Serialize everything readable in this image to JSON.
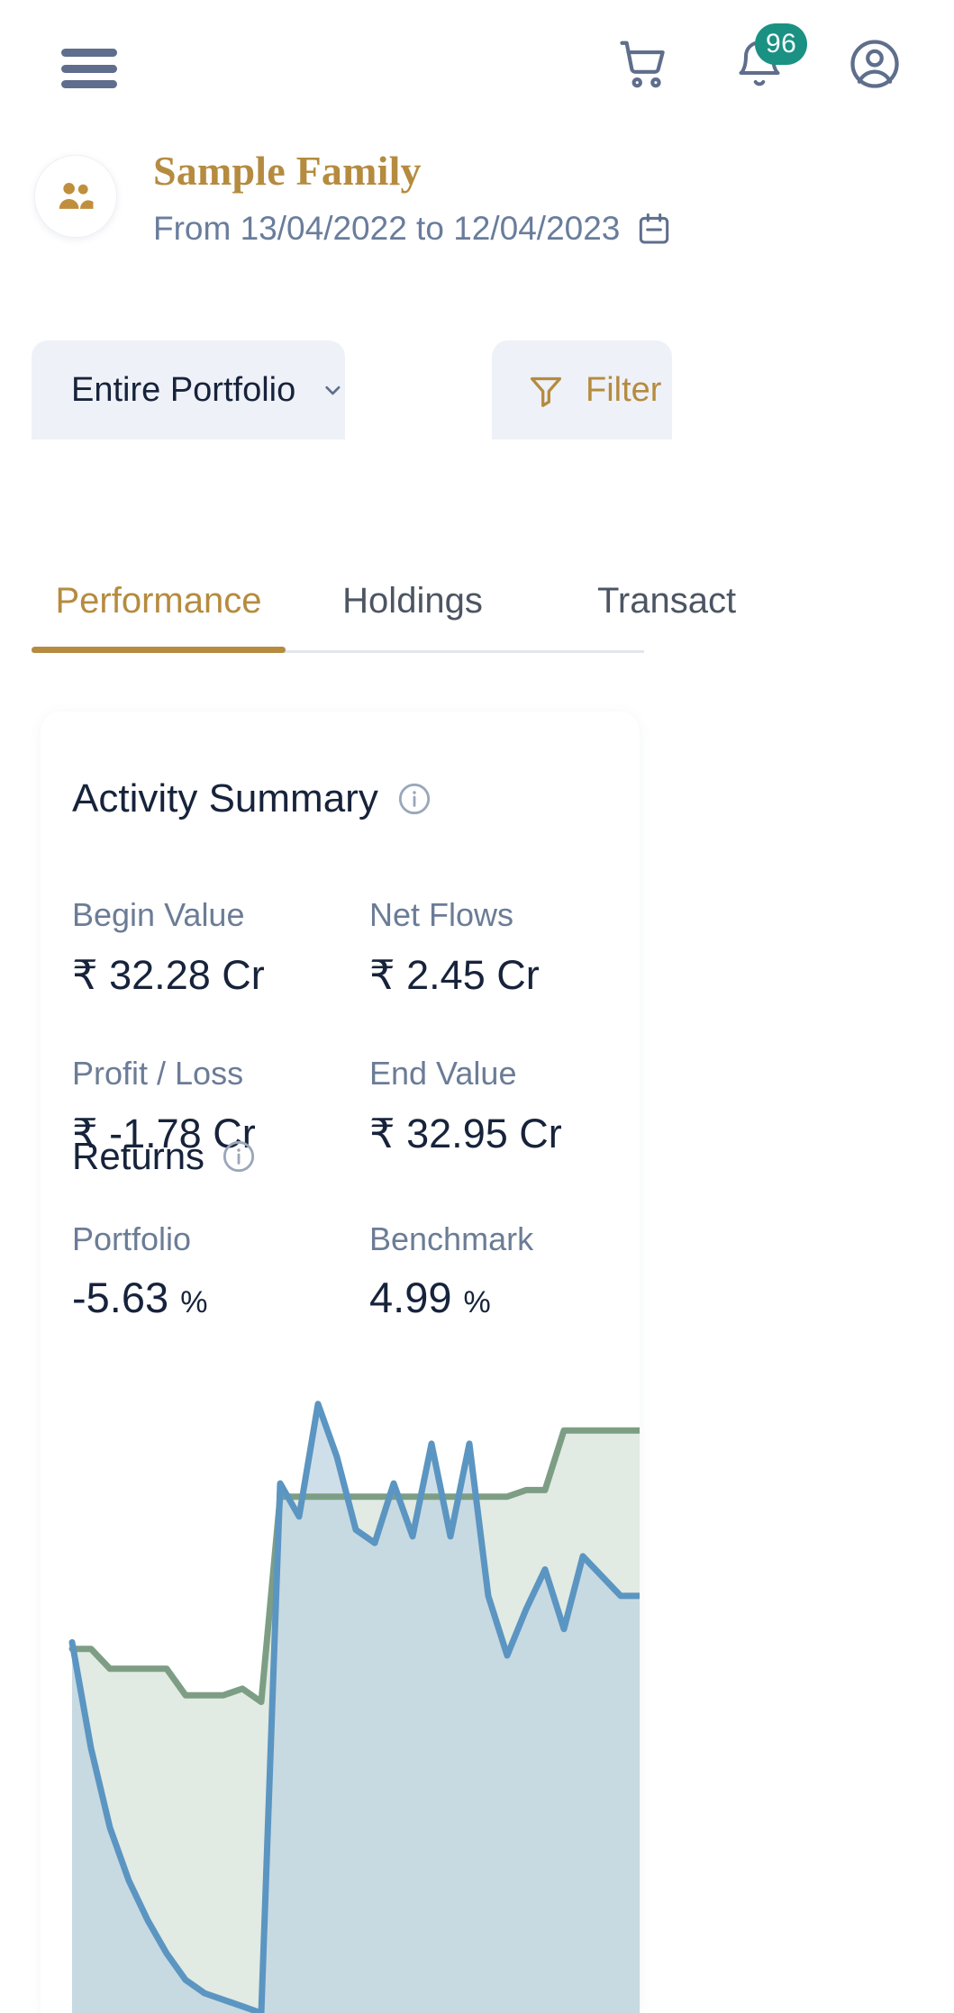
{
  "appbar": {
    "menu_icon": "hamburger-menu-icon",
    "cart_icon": "shopping-cart-icon",
    "bell_icon": "notification-bell-icon",
    "profile_icon": "user-account-icon",
    "notification_count": "96",
    "badge_color": "#1a9183"
  },
  "family": {
    "avatar_icon": "family-group-icon",
    "name": "Sample Family",
    "date_range": "From 13/04/2022 to 12/04/2023",
    "calendar_icon": "calendar-icon",
    "name_color": "#b58b3f"
  },
  "segments": {
    "portfolio_label": "Entire Portfolio",
    "portfolio_chevron_icon": "chevron-down-icon",
    "filter_label": "Filter",
    "filter_icon": "funnel-filter-icon"
  },
  "tabs": [
    {
      "label": "Performance",
      "active": true
    },
    {
      "label": "Holdings",
      "active": false
    },
    {
      "label": "Transact",
      "active": false
    }
  ],
  "activity_summary": {
    "title": "Activity Summary",
    "info_icon": "info-icon",
    "metrics": [
      {
        "label": "Begin Value",
        "value": "₹ 32.28 Cr"
      },
      {
        "label": "Net Flows",
        "value": "₹ 2.45 Cr"
      },
      {
        "label": "Profit / Loss",
        "value": "₹ -1.78 Cr"
      },
      {
        "label": "End Value",
        "value": "₹ 32.95 Cr"
      }
    ]
  },
  "returns": {
    "title": "Returns",
    "info_icon": "info-icon",
    "portfolio_label": "Portfolio",
    "portfolio_value": "-5.63",
    "portfolio_unit": "%",
    "benchmark_label": "Benchmark",
    "benchmark_value": "4.99",
    "benchmark_unit": "%"
  },
  "chart_data": {
    "type": "area",
    "title": "",
    "xlabel": "",
    "ylabel": "",
    "grid": false,
    "legend_position": "none",
    "ylim": [
      0,
      100
    ],
    "series": [
      {
        "name": "Benchmark",
        "color": "#7d9e84",
        "fill": "#dfe9e1",
        "values": [
          55,
          55,
          52,
          52,
          52,
          52,
          48,
          48,
          48,
          49,
          47,
          78,
          78,
          78,
          78,
          78,
          78,
          78,
          78,
          78,
          78,
          78,
          78,
          78,
          79,
          79,
          88,
          88,
          88,
          88,
          88
        ]
      },
      {
        "name": "Portfolio",
        "color": "#5b95c2",
        "fill": "#bcd3e0",
        "values": [
          56,
          40,
          28,
          20,
          14,
          9,
          5,
          3,
          2,
          1,
          0,
          80,
          75,
          92,
          84,
          73,
          71,
          80,
          72,
          86,
          72,
          86,
          63,
          54,
          61,
          67,
          58,
          69,
          66,
          63,
          63
        ]
      }
    ]
  }
}
